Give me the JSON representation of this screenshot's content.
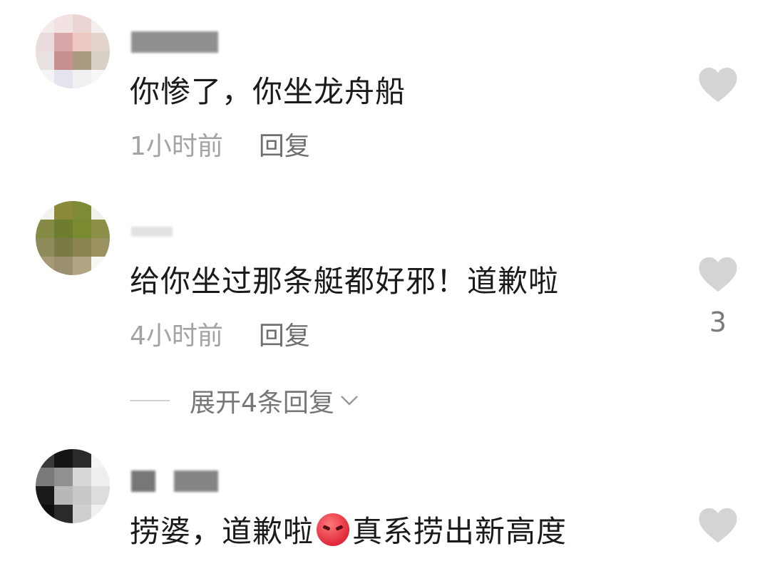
{
  "comments": [
    {
      "text": "你惨了，你坐龙舟船",
      "time": "1小时前",
      "reply": "回复",
      "likes": ""
    },
    {
      "text": "给你坐过那条艇都好邪！道歉啦",
      "time": "4小时前",
      "reply": "回复",
      "likes": "3"
    },
    {
      "text_before_emoji": "捞婆，道歉啦",
      "emoji": "angry-face-emoji",
      "text_after_emoji": "真系捞出新高度",
      "likes": ""
    }
  ],
  "expand_replies": {
    "label": "展开4条回复"
  },
  "icons": {
    "like": "heart-icon",
    "expand": "chevron-down-icon"
  },
  "colors": {
    "text": "#1a1a1a",
    "meta": "#a3a3a3",
    "reply": "#6f6f6f",
    "heart": "#d4d4d4"
  }
}
